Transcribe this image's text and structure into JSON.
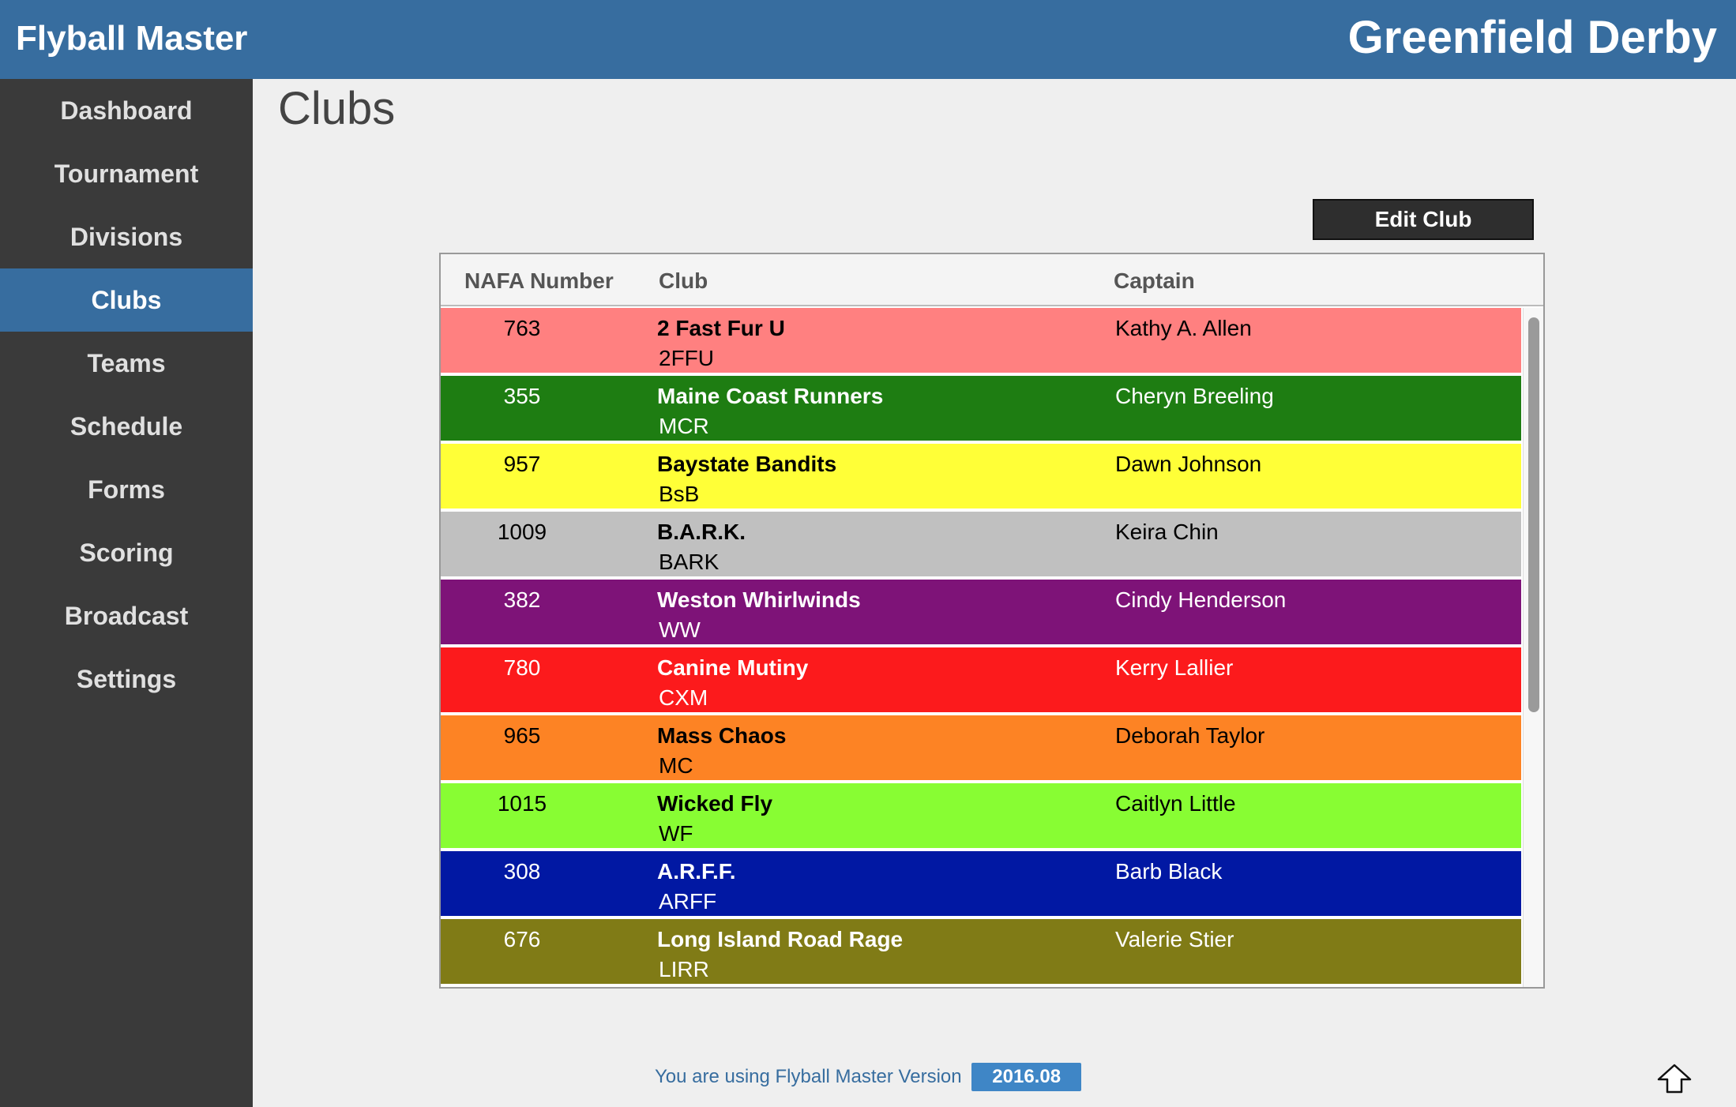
{
  "header": {
    "app_title": "Flyball Master",
    "event_title": "Greenfield Derby"
  },
  "sidebar": {
    "items": [
      {
        "label": "Dashboard",
        "active": false
      },
      {
        "label": "Tournament",
        "active": false
      },
      {
        "label": "Divisions",
        "active": false
      },
      {
        "label": "Clubs",
        "active": true
      },
      {
        "label": "Teams",
        "active": false
      },
      {
        "label": "Schedule",
        "active": false
      },
      {
        "label": "Forms",
        "active": false
      },
      {
        "label": "Scoring",
        "active": false
      },
      {
        "label": "Broadcast",
        "active": false
      },
      {
        "label": "Settings",
        "active": false
      }
    ]
  },
  "main": {
    "title": "Clubs",
    "edit_button": "Edit Club",
    "columns": {
      "nafa": "NAFA Number",
      "club": "Club",
      "captain": "Captain"
    },
    "clubs": [
      {
        "nafa": "763",
        "name": "2 Fast Fur U",
        "abbr": "2FFU",
        "captain": "Kathy A. Allen",
        "bg": "#ff8080",
        "fg": "#000000"
      },
      {
        "nafa": "355",
        "name": "Maine Coast Runners",
        "abbr": "MCR",
        "captain": "Cheryn Breeling",
        "bg": "#1e7d12",
        "fg": "#ffffff"
      },
      {
        "nafa": "957",
        "name": "Baystate Bandits",
        "abbr": "BsB",
        "captain": "Dawn Johnson",
        "bg": "#ffff37",
        "fg": "#000000"
      },
      {
        "nafa": "1009",
        "name": "B.A.R.K.",
        "abbr": "BARK",
        "captain": "Keira Chin",
        "bg": "#c0c0c0",
        "fg": "#000000"
      },
      {
        "nafa": "382",
        "name": "Weston Whirlwinds",
        "abbr": "WW",
        "captain": "Cindy Henderson",
        "bg": "#7e1378",
        "fg": "#ffffff"
      },
      {
        "nafa": "780",
        "name": "Canine Mutiny",
        "abbr": "CXM",
        "captain": "Kerry Lallier",
        "bg": "#fc1a1c",
        "fg": "#ffffff"
      },
      {
        "nafa": "965",
        "name": "Mass Chaos",
        "abbr": "MC",
        "captain": "Deborah Taylor",
        "bg": "#fd8324",
        "fg": "#000000"
      },
      {
        "nafa": "1015",
        "name": "Wicked Fly",
        "abbr": "WF",
        "captain": "Caitlyn Little",
        "bg": "#88fd33",
        "fg": "#000000"
      },
      {
        "nafa": "308",
        "name": "A.R.F.F.",
        "abbr": "ARFF",
        "captain": "Barb Black",
        "bg": "#0118a3",
        "fg": "#ffffff"
      },
      {
        "nafa": "676",
        "name": "Long Island Road Rage",
        "abbr": "LIRR",
        "captain": "Valerie Stier",
        "bg": "#807b16",
        "fg": "#ffffff"
      }
    ]
  },
  "footer": {
    "version_text": "You are using Flyball Master Version",
    "version": "2016.08",
    "up_icon": "up-arrow-icon"
  }
}
